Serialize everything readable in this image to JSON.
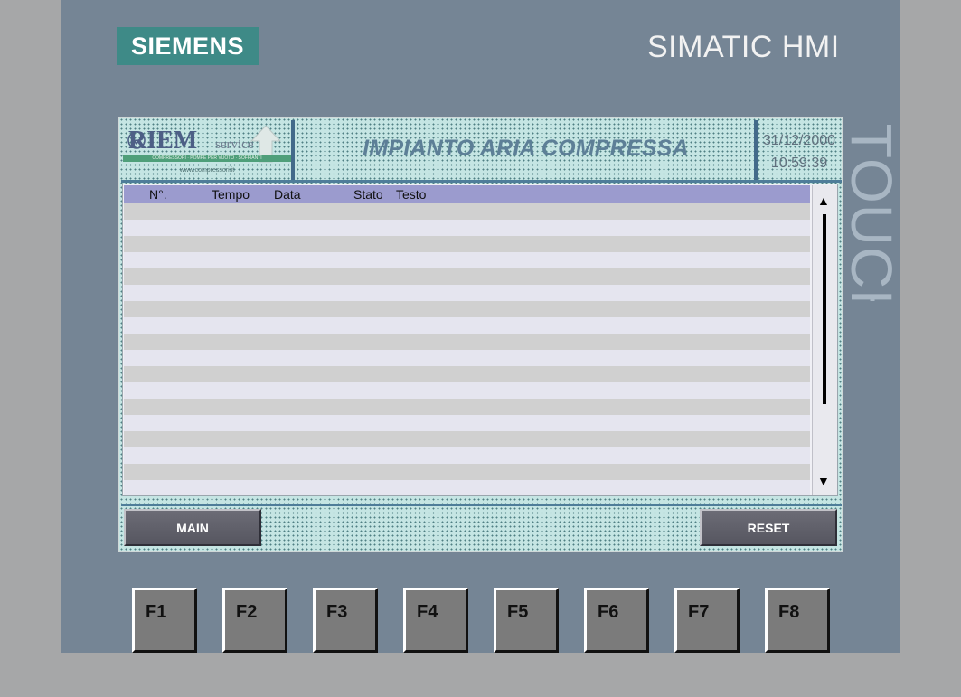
{
  "device": {
    "brand": "SIEMENS",
    "model": "SIMATIC HMI",
    "touch_label": "TOUCH"
  },
  "header": {
    "logo_text": "RIEM",
    "logo_service": "service",
    "logo_tagline": "COMPRESSORI · POMPE PER VUOTO · SOFFIANTI",
    "logo_web": "www.compressori.it",
    "title": "IMPIANTO ARIA COMPRESSA",
    "date": "31/12/2000",
    "time": "10:59:39"
  },
  "alarm_view": {
    "columns": [
      "N°.",
      "Tempo",
      "Data",
      "Stato",
      "Testo"
    ],
    "rows": []
  },
  "buttons": {
    "main": "MAIN",
    "reset": "RESET"
  },
  "function_keys": [
    "F1",
    "F2",
    "F3",
    "F4",
    "F5",
    "F6",
    "F7",
    "F8"
  ],
  "colors": {
    "bezel": "#758595",
    "brand_block": "#3e8a87",
    "header_row": "#9b9bce",
    "screen_bg": "#c5e5e3"
  },
  "icons": {
    "scroll_up": "triangle-up-icon",
    "scroll_down": "triangle-down-icon"
  }
}
